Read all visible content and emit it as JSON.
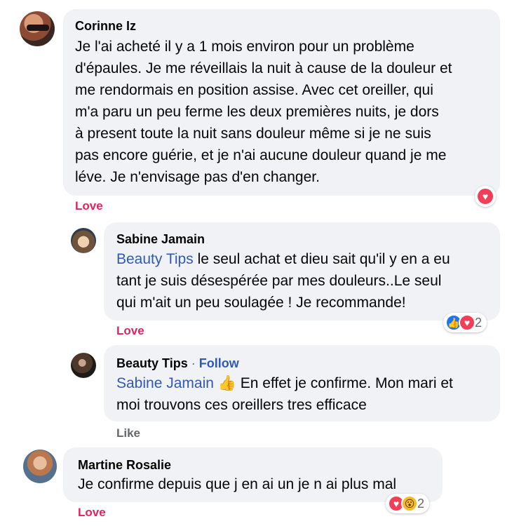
{
  "comments": [
    {
      "author": "Corinne Iz",
      "lines": [
        "Je l'ai acheté il y a 1 mois environ pour un problème",
        "d'épaules. Je me réveillais la nuit à cause de la douleur et",
        "me rendormais en position assise. Avec cet oreiller, qui",
        "m'a paru un peu ferme les deux premières nuits, je dors",
        "à present toute la nuit sans douleur même si je ne suis",
        "pas encore guérie, et je n'ai aucune douleur quand je me",
        "léve. Je n'envisage pas d'en changer."
      ],
      "action": "Love",
      "reactions": [
        "heart-icon"
      ]
    },
    {
      "author": "Sabine Jamain",
      "mention": "Beauty Tips",
      "line1_rest": " le seul achat et dieu sait qu'il y en a eu",
      "lines": [
        "tant je suis désespérée par mes douleurs..Le seul",
        "qui m'ait un peu soulagée ! Je recommande!"
      ],
      "action": "Love",
      "reactions": [
        "like-icon",
        "heart-icon"
      ],
      "reaction_count": "2"
    },
    {
      "author": "Beauty Tips",
      "separator": "·",
      "follow": "Follow",
      "mention": "Sabine Jamain",
      "emoji": "👍",
      "line1_rest": " En effet je confirme. Mon mari et",
      "lines": [
        "moi trouvons ces oreillers tres efficace"
      ],
      "action": "Like"
    },
    {
      "author": "Martine Rosalie",
      "lines": [
        "Je confirme depuis que j en ai un je n ai plus mal"
      ],
      "action": "Love",
      "reactions": [
        "heart-icon",
        "wow-icon"
      ],
      "reaction_count": "2"
    }
  ],
  "colors": {
    "bubble": "#f0f2f5",
    "mention": "#2f5ab8",
    "love": "#e0245e",
    "muted": "#65676b"
  }
}
